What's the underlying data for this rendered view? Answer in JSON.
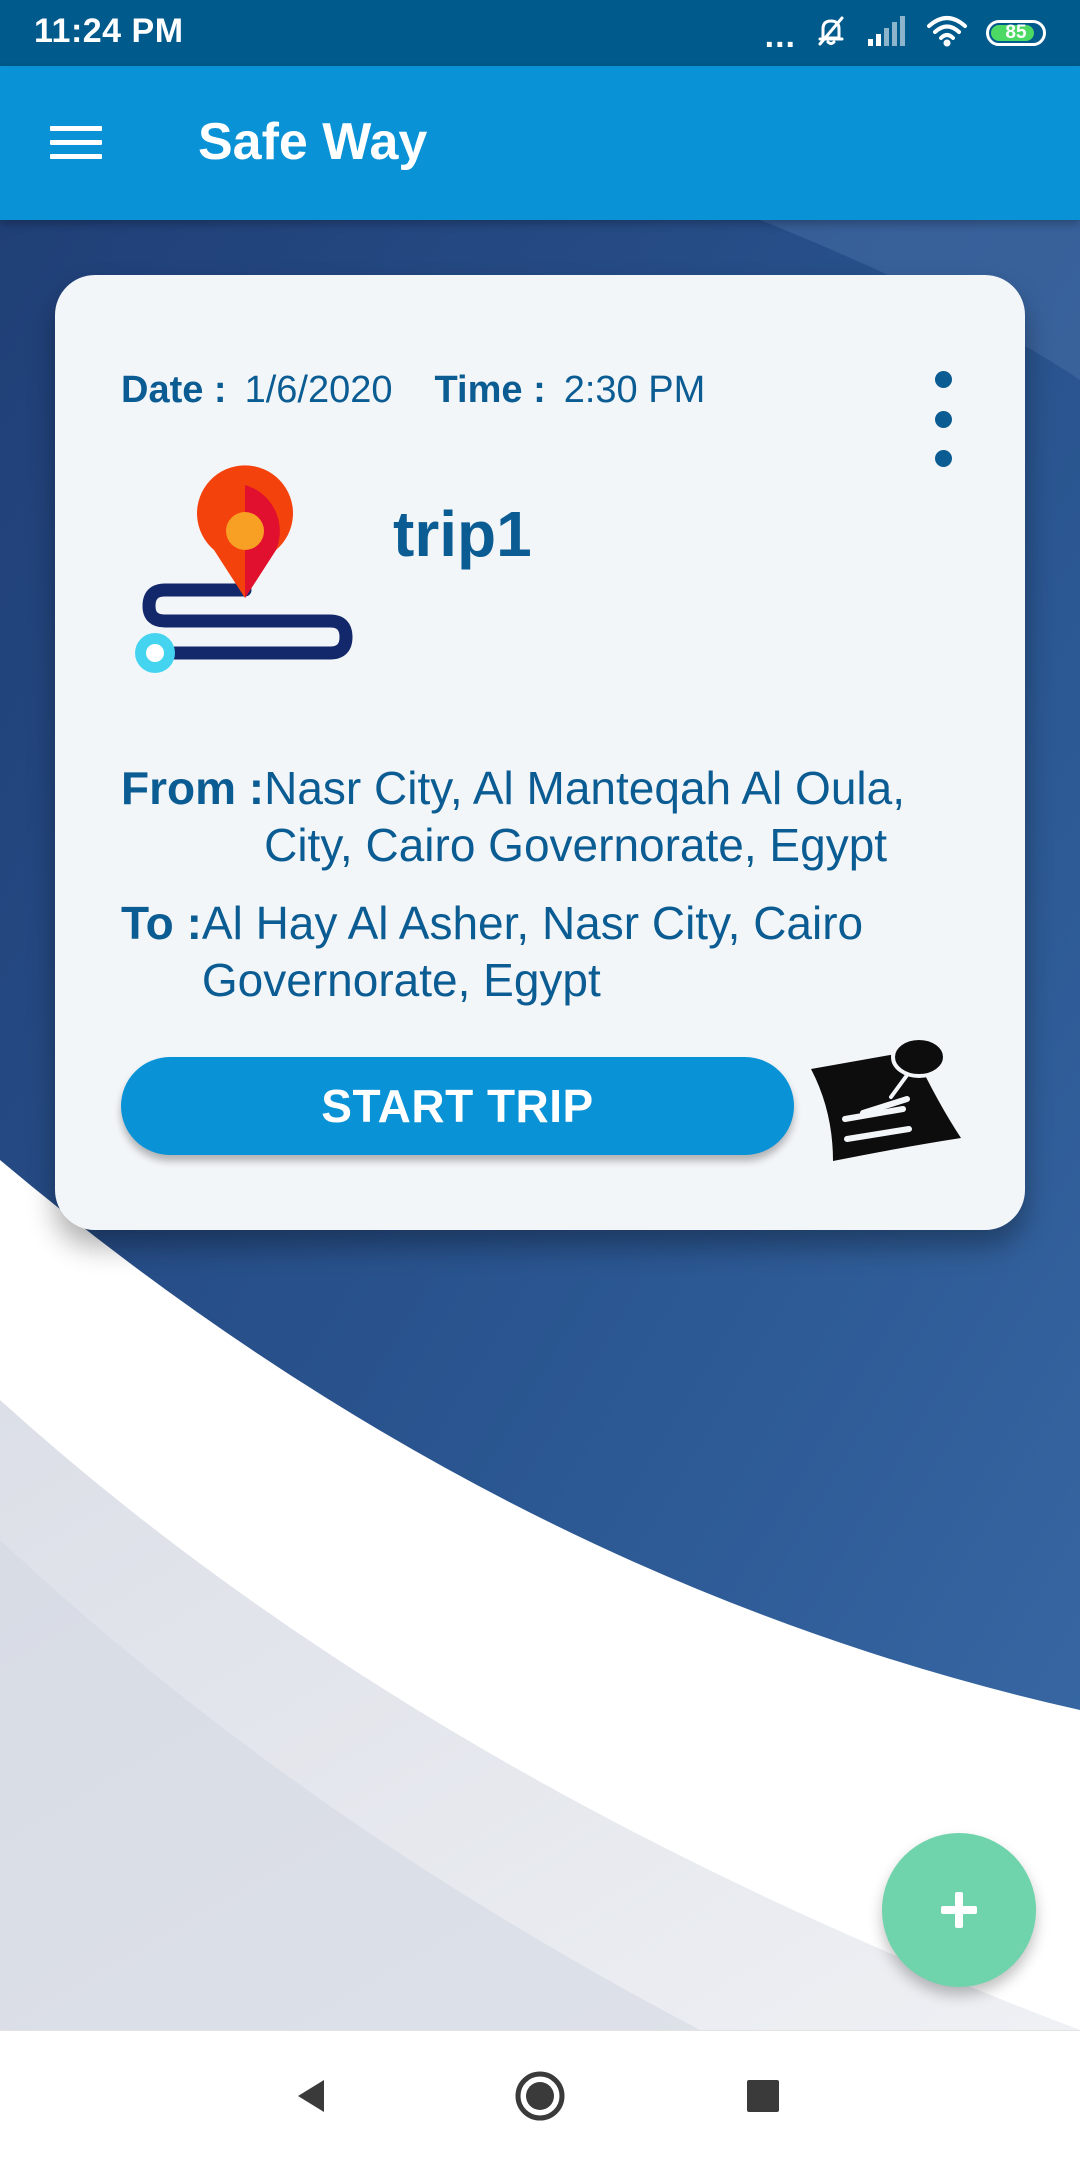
{
  "status_bar": {
    "time": "11:24 PM",
    "more_indicator": "...",
    "icons": [
      "mute-icon",
      "signal-icon",
      "wifi-icon",
      "battery-icon"
    ],
    "battery_level": "85"
  },
  "app_bar": {
    "title": "Safe Way",
    "menu_icon": "hamburger-menu-icon"
  },
  "trip_card": {
    "date_label": "Date :",
    "date_value": "1/6/2020",
    "time_label": "Time :",
    "time_value": "2:30 PM",
    "name": "trip1",
    "from_label": "From :",
    "from_value": "Nasr City, Al Manteqah Al Oula, City, Cairo Governorate, Egypt",
    "to_label": "To :",
    "to_value": "Al Hay Al Asher, Nasr City, Cairo Governorate, Egypt",
    "start_button_label": "START TRIP",
    "more_icon": "more-vertical-icon",
    "notes_icon": "sticky-note-icon",
    "route_icon": "route-map-pin-icon"
  },
  "fab": {
    "icon": "plus-icon"
  },
  "nav_bar": {
    "icons": [
      "back-icon",
      "home-icon",
      "recents-icon"
    ]
  },
  "colors": {
    "status_bar": "#015a8c",
    "app_bar": "#0a92d6",
    "card_background": "#f3f6f9",
    "text_primary": "#0b5c93",
    "button": "#0a92d6",
    "fab": "#6fd3ac",
    "battery": "#4cd964"
  }
}
